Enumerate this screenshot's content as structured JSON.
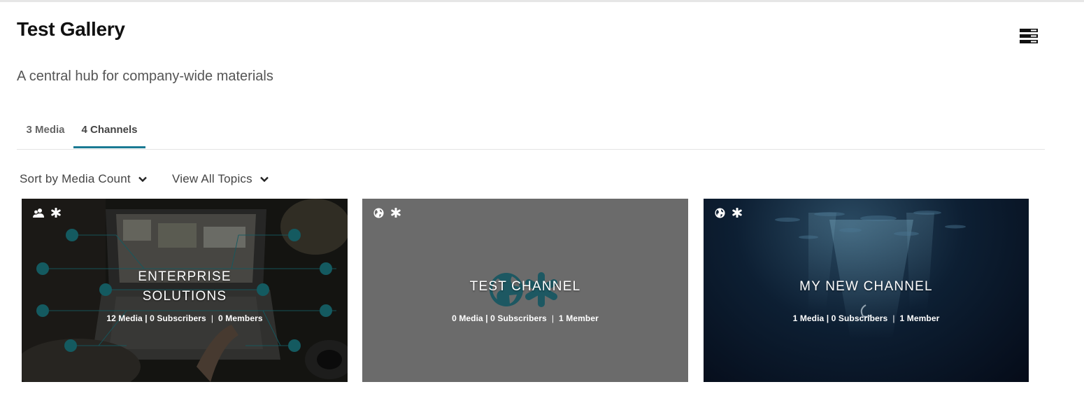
{
  "page": {
    "title": "Test Gallery",
    "description": "A central hub for company-wide materials",
    "layout_icon": "list-layout-icon"
  },
  "tabs": [
    {
      "label": "3 Media",
      "active": false
    },
    {
      "label": "4 Channels",
      "active": true
    }
  ],
  "filters": {
    "sort_label": "Sort by Media Count",
    "topics_label": "View All Topics"
  },
  "channels": [
    {
      "title_line1": "ENTERPRISE",
      "title_line2": "SOLUTIONS",
      "media": "12 Media |",
      "subscribers": "0 Subscribers",
      "members": "0 Members",
      "icons": [
        "users-icon",
        "asterisk-icon"
      ]
    },
    {
      "title_line1": "TEST CHANNEL",
      "media": "0 Media |",
      "subscribers": "0 Subscribers",
      "members": "1 Member",
      "icons": [
        "globe-icon",
        "asterisk-icon"
      ]
    },
    {
      "title_line1": "MY NEW CHANNEL",
      "media": "1 Media |",
      "subscribers": "0 Subscribers",
      "members": "1 Member",
      "icons": [
        "globe-icon",
        "asterisk-icon"
      ]
    }
  ],
  "colors": {
    "accent": "#1b7a93",
    "teal_icon": "#1f8a94",
    "card_gray": "#6b6b6b",
    "card_navy": "#0d1f33"
  }
}
